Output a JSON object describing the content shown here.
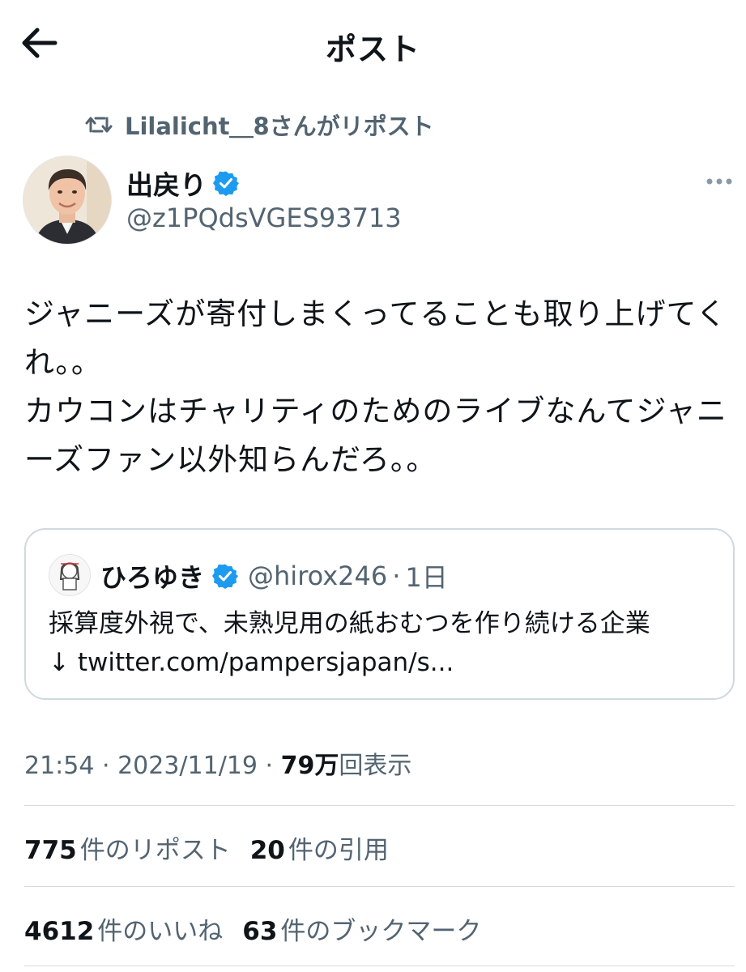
{
  "header": {
    "back_icon": "arrow-left-icon",
    "title": "ポスト"
  },
  "repost": {
    "icon": "repost-icon",
    "text": "Lilalicht＿8さんがリポスト"
  },
  "tweet": {
    "author_name": "出戻り",
    "verified_icon": "verified-badge-icon",
    "handle": "@z1PQdsVGES93713",
    "more_icon": "more-dots-icon",
    "text": "ジャニーズが寄付しまくってることも取り上げてくれ。。\nカウコンはチャリティのためのライブなんてジャニーズファン以外知らんだろ。。"
  },
  "quote": {
    "author_name": "ひろゆき",
    "handle": "@hirox246",
    "separator": "·",
    "time": "1日",
    "text": "採算度外視で、未熟児用の紙おむつを作り続ける企業\n↓ twitter.com/pampersjapan/s..."
  },
  "meta": {
    "time": "21:54",
    "sep1": " · ",
    "date": "2023/11/19",
    "sep2": " · ",
    "views_count": "79万",
    "views_label": "回表示"
  },
  "stats_row1": [
    {
      "count": "775",
      "label": "件のリポスト"
    },
    {
      "count": "20",
      "label": "件の引用"
    }
  ],
  "stats_row2": [
    {
      "count": "4612",
      "label": "件のいいね"
    },
    {
      "count": "63",
      "label": "件のブックマーク"
    }
  ],
  "colors": {
    "accent": "#1d9bf0",
    "secondary_text": "#536471",
    "border": "#cfd9de"
  }
}
